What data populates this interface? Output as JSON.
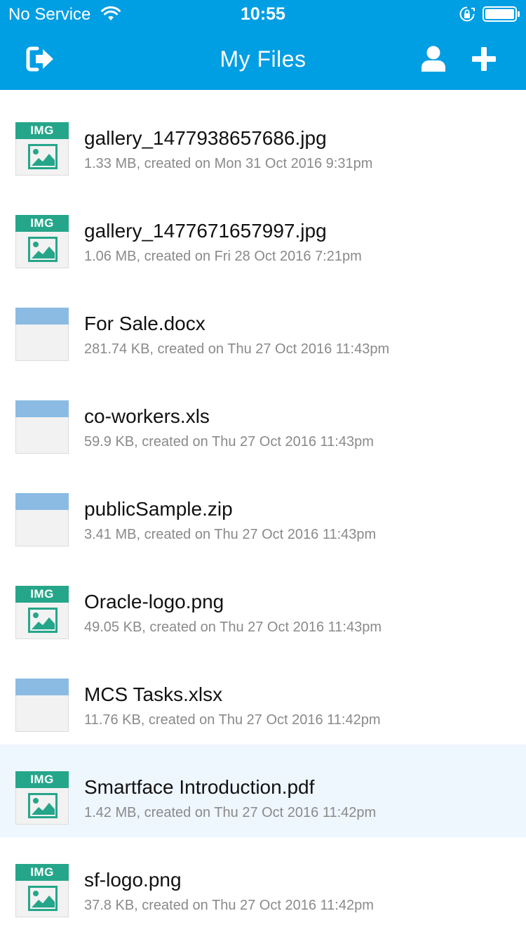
{
  "status_bar": {
    "carrier": "No Service",
    "time": "10:55",
    "icons": [
      "wifi-icon",
      "lock-rotation-icon",
      "battery-icon"
    ]
  },
  "nav": {
    "title": "My Files",
    "left_button_icon": "logout-icon",
    "right_buttons": [
      "profile-icon",
      "add-icon"
    ]
  },
  "colors": {
    "header": "#009ee3",
    "image_thumb": "#25a68a",
    "doc_thumb": "#8bbbe3",
    "selected_row": "#eef6fe"
  },
  "files": [
    {
      "name": "gallery_1477938657686.jpg",
      "meta": "1.33 MB, created on Mon 31 Oct 2016 9:31pm",
      "thumb": "image",
      "thumb_label": "IMG",
      "selected": false
    },
    {
      "name": "gallery_1477671657997.jpg",
      "meta": "1.06 MB, created on Fri 28 Oct 2016 7:21pm",
      "thumb": "image",
      "thumb_label": "IMG",
      "selected": false
    },
    {
      "name": "For Sale.docx",
      "meta": "281.74 KB, created on Thu 27 Oct 2016 11:43pm",
      "thumb": "document",
      "thumb_label": "",
      "selected": false
    },
    {
      "name": "co-workers.xls",
      "meta": "59.9 KB, created on Thu 27 Oct 2016 11:43pm",
      "thumb": "document",
      "thumb_label": "",
      "selected": false
    },
    {
      "name": "publicSample.zip",
      "meta": "3.41 MB, created on Thu 27 Oct 2016 11:43pm",
      "thumb": "document",
      "thumb_label": "",
      "selected": false
    },
    {
      "name": "Oracle-logo.png",
      "meta": "49.05 KB, created on Thu 27 Oct 2016 11:43pm",
      "thumb": "image",
      "thumb_label": "IMG",
      "selected": false
    },
    {
      "name": "MCS Tasks.xlsx",
      "meta": "11.76 KB, created on Thu 27 Oct 2016 11:42pm",
      "thumb": "document",
      "thumb_label": "",
      "selected": false
    },
    {
      "name": "Smartface Introduction.pdf",
      "meta": "1.42 MB, created on Thu 27 Oct 2016 11:42pm",
      "thumb": "image",
      "thumb_label": "IMG",
      "selected": true
    },
    {
      "name": "sf-logo.png",
      "meta": "37.8 KB, created on Thu 27 Oct 2016 11:42pm",
      "thumb": "image",
      "thumb_label": "IMG",
      "selected": false
    }
  ]
}
